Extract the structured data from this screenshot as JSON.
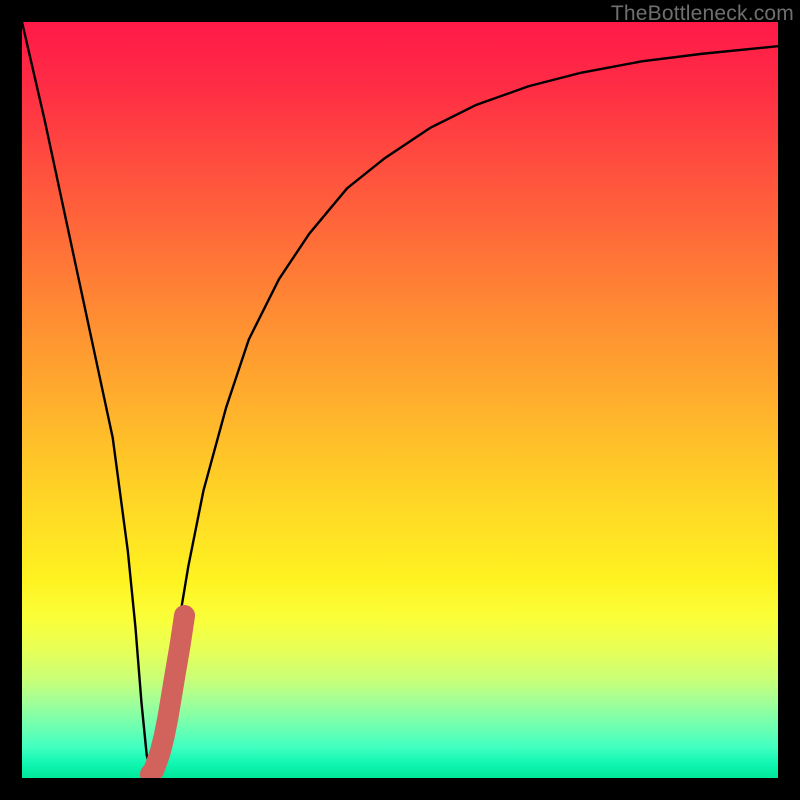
{
  "watermark": "TheBottleneck.com",
  "colors": {
    "frame": "#000000",
    "gradient_top": "#ff1a48",
    "gradient_mid": "#ffe024",
    "gradient_bottom": "#00e89a",
    "curve": "#000000",
    "marker": "#d1635c"
  },
  "chart_data": {
    "type": "line",
    "title": "",
    "xlabel": "",
    "ylabel": "",
    "xlim": [
      0,
      100
    ],
    "ylim": [
      0,
      100
    ],
    "series": [
      {
        "name": "bottleneck-curve",
        "x": [
          0,
          3,
          6,
          9,
          12,
          14,
          15,
          15.8,
          16.5,
          17.3,
          18,
          19,
          20,
          22,
          24,
          27,
          30,
          34,
          38,
          43,
          48,
          54,
          60,
          67,
          74,
          82,
          90,
          100
        ],
        "values": [
          100,
          87,
          73,
          59,
          45,
          30,
          20,
          10,
          3,
          0,
          3,
          9,
          16,
          28,
          38,
          49,
          58,
          66,
          72,
          78,
          82,
          86,
          89,
          91.5,
          93.3,
          94.8,
          95.8,
          96.8
        ]
      },
      {
        "name": "highlight-marker",
        "x": [
          17.0,
          17.4,
          17.8,
          18.3,
          18.8,
          19.3,
          19.8,
          20.3,
          20.9,
          21.5
        ],
        "values": [
          0.5,
          1.0,
          2.0,
          3.5,
          5.5,
          8.0,
          11.0,
          14.0,
          17.5,
          21.5
        ]
      }
    ],
    "annotations": []
  }
}
